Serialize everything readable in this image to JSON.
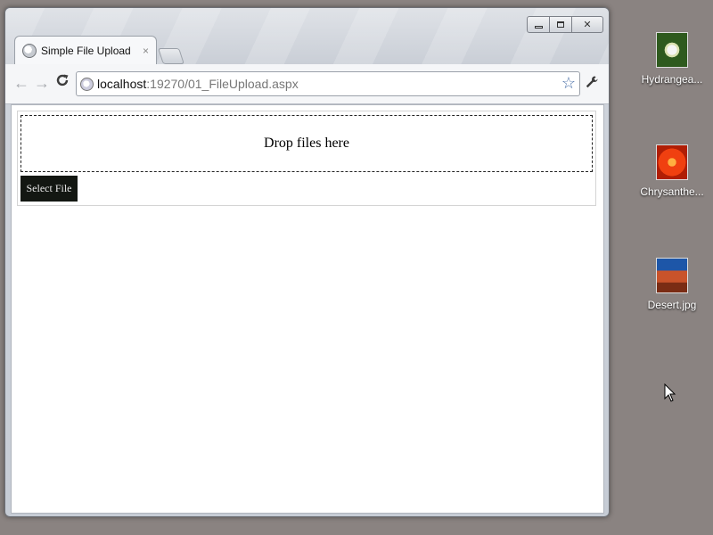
{
  "browser": {
    "tab": {
      "title": "Simple File Upload",
      "close": "×"
    },
    "window_controls": {
      "close": "✕"
    },
    "nav": {
      "back": "←",
      "forward": "→",
      "reload": "C"
    },
    "address": {
      "host": "localhost",
      "path": ":19270/01_FileUpload.aspx"
    },
    "star": "☆",
    "wrench": "🔧"
  },
  "page": {
    "drop_zone_text": "Drop files here",
    "select_button_label": "Select File"
  },
  "desktop": {
    "icons": [
      {
        "label": "Hydrangea..."
      },
      {
        "label": "Chrysanthe..."
      },
      {
        "label": "Desert.jpg"
      }
    ]
  }
}
